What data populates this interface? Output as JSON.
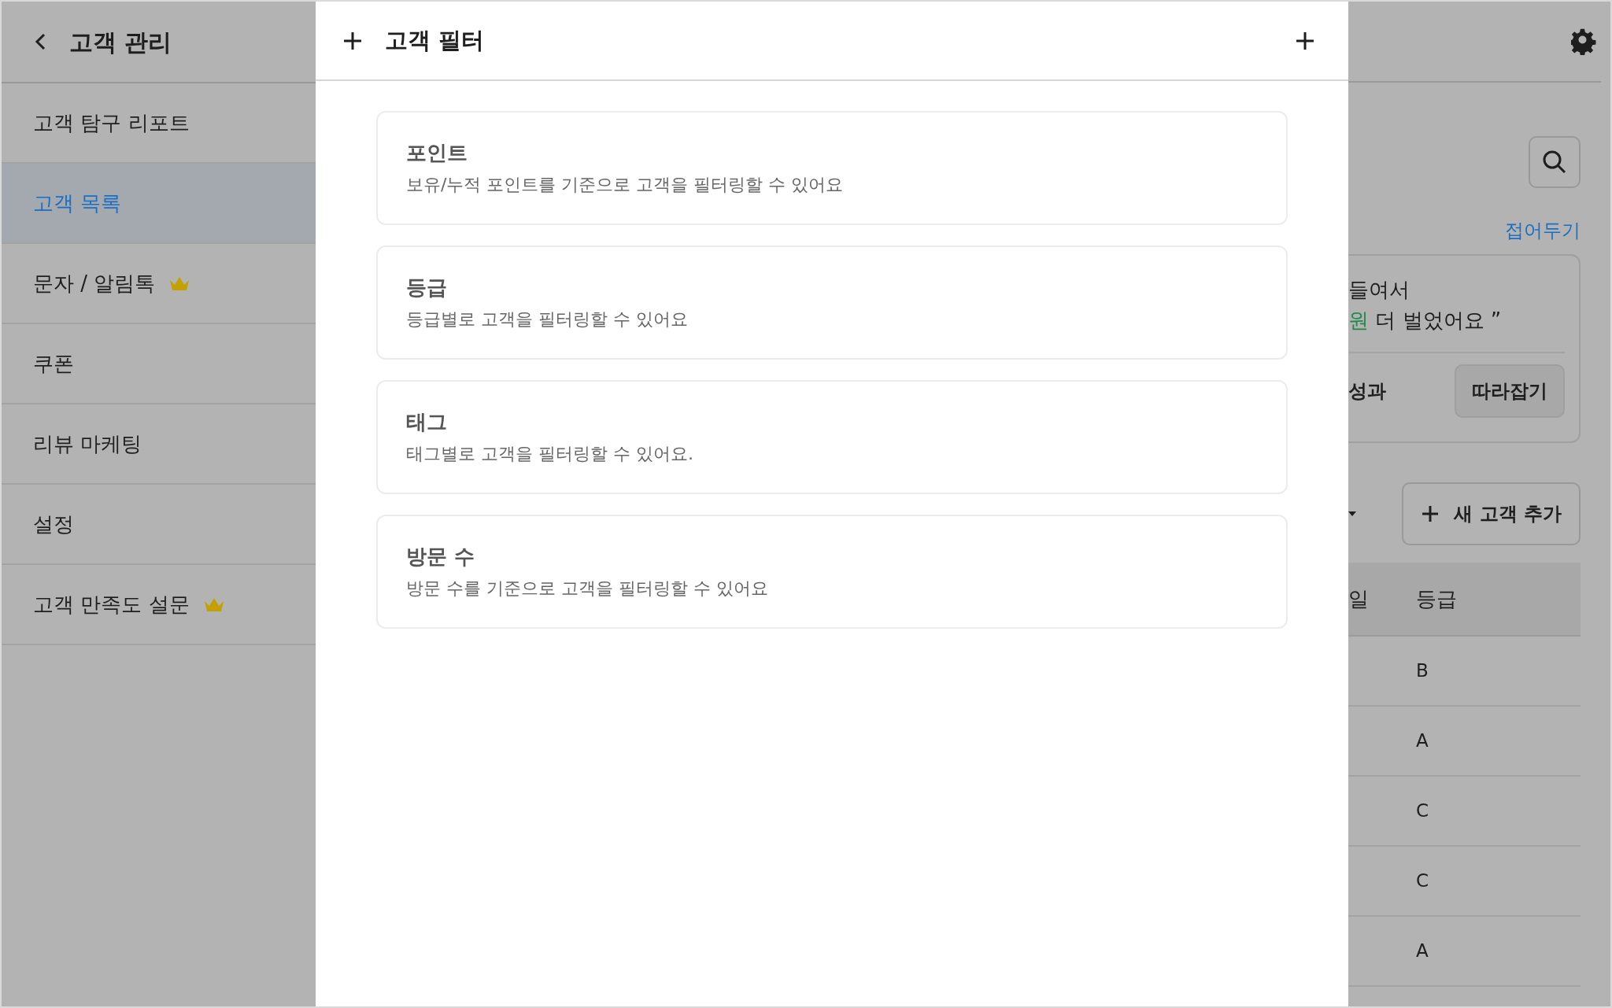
{
  "sidebar": {
    "title": "고객 관리",
    "items": [
      {
        "label": "고객 탐구 리포트",
        "selected": false,
        "premium": false
      },
      {
        "label": "고객 목록",
        "selected": true,
        "premium": false
      },
      {
        "label": "문자 / 알림톡",
        "selected": false,
        "premium": true
      },
      {
        "label": "쿠폰",
        "selected": false,
        "premium": false
      },
      {
        "label": "리뷰 마케팅",
        "selected": false,
        "premium": false
      },
      {
        "label": "설정",
        "selected": false,
        "premium": false
      },
      {
        "label": "고객 만족도 설문",
        "selected": false,
        "premium": true
      }
    ]
  },
  "modal": {
    "title": "고객 필터",
    "filters": [
      {
        "title": "포인트",
        "description": "보유/누적 포인트를 기준으로 고객을 필터링할 수 있어요"
      },
      {
        "title": "등급",
        "description": "등급별로 고객을 필터링할 수 있어요"
      },
      {
        "title": "태그",
        "description": "태그별로 고객을 필터링할 수 있어요."
      },
      {
        "title": "방문 수",
        "description": "방문 수를 기준으로 고객을 필터링할 수 있어요"
      }
    ]
  },
  "background": {
    "collapse_link": "접어두기",
    "promo": {
      "line_1": "들여서",
      "highlight": "원",
      "line_2": "더 벌었어요 ”",
      "label": "성과",
      "button": "따라잡기"
    },
    "add_button": "새 고객 추가",
    "table": {
      "columns": [
        "일",
        "등급"
      ],
      "rows": [
        [
          "B"
        ],
        [
          "A"
        ],
        [
          "C"
        ],
        [
          "C"
        ],
        [
          "A"
        ]
      ]
    }
  }
}
